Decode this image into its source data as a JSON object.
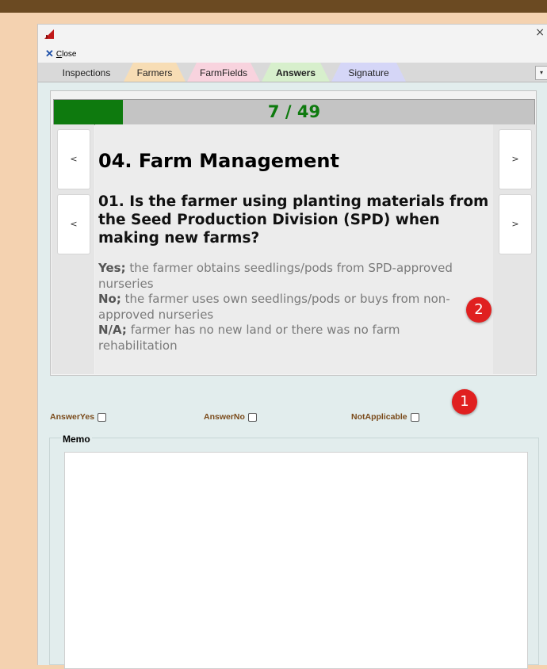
{
  "window": {
    "close_symbol": "×"
  },
  "toolbar": {
    "close_label": "Close"
  },
  "tabs": [
    {
      "label": "Inspections",
      "color": "#d9d9d9",
      "active": false
    },
    {
      "label": "Farmers",
      "color": "#f7ddb5",
      "active": false
    },
    {
      "label": "FarmFields",
      "color": "#f8d3de",
      "active": false
    },
    {
      "label": "Answers",
      "color": "#d7efcc",
      "active": true
    },
    {
      "label": "Signature",
      "color": "#d5d6f7",
      "active": false
    }
  ],
  "progress": {
    "current": 7,
    "total": 49,
    "fraction": 0.1429,
    "label": "7 / 49",
    "fill_color": "#0e7a0e"
  },
  "nav": {
    "prev_symbol": "<",
    "next_symbol": ">"
  },
  "question": {
    "section": "04. Farm Management",
    "text": "01. Is the farmer using planting materials from the Seed Production Division (SPD) when making new farms?",
    "guide": [
      {
        "key": "Yes;",
        "text": " the farmer obtains seedlings/pods from SPD-approved nurseries"
      },
      {
        "key": "No;",
        "text": " the farmer uses own seedlings/pods or buys from non-approved nurseries"
      },
      {
        "key": "N/A;",
        "text": " farmer has no new land or there was no farm rehabilitation"
      }
    ]
  },
  "answers": {
    "yes_label": "AnswerYes",
    "no_label": "AnswerNo",
    "na_label": "NotApplicable",
    "yes_checked": false,
    "no_checked": false,
    "na_checked": false
  },
  "memo": {
    "label": "Memo",
    "value": ""
  },
  "badges": {
    "one": "1",
    "two": "2",
    "color": "#e02020"
  }
}
